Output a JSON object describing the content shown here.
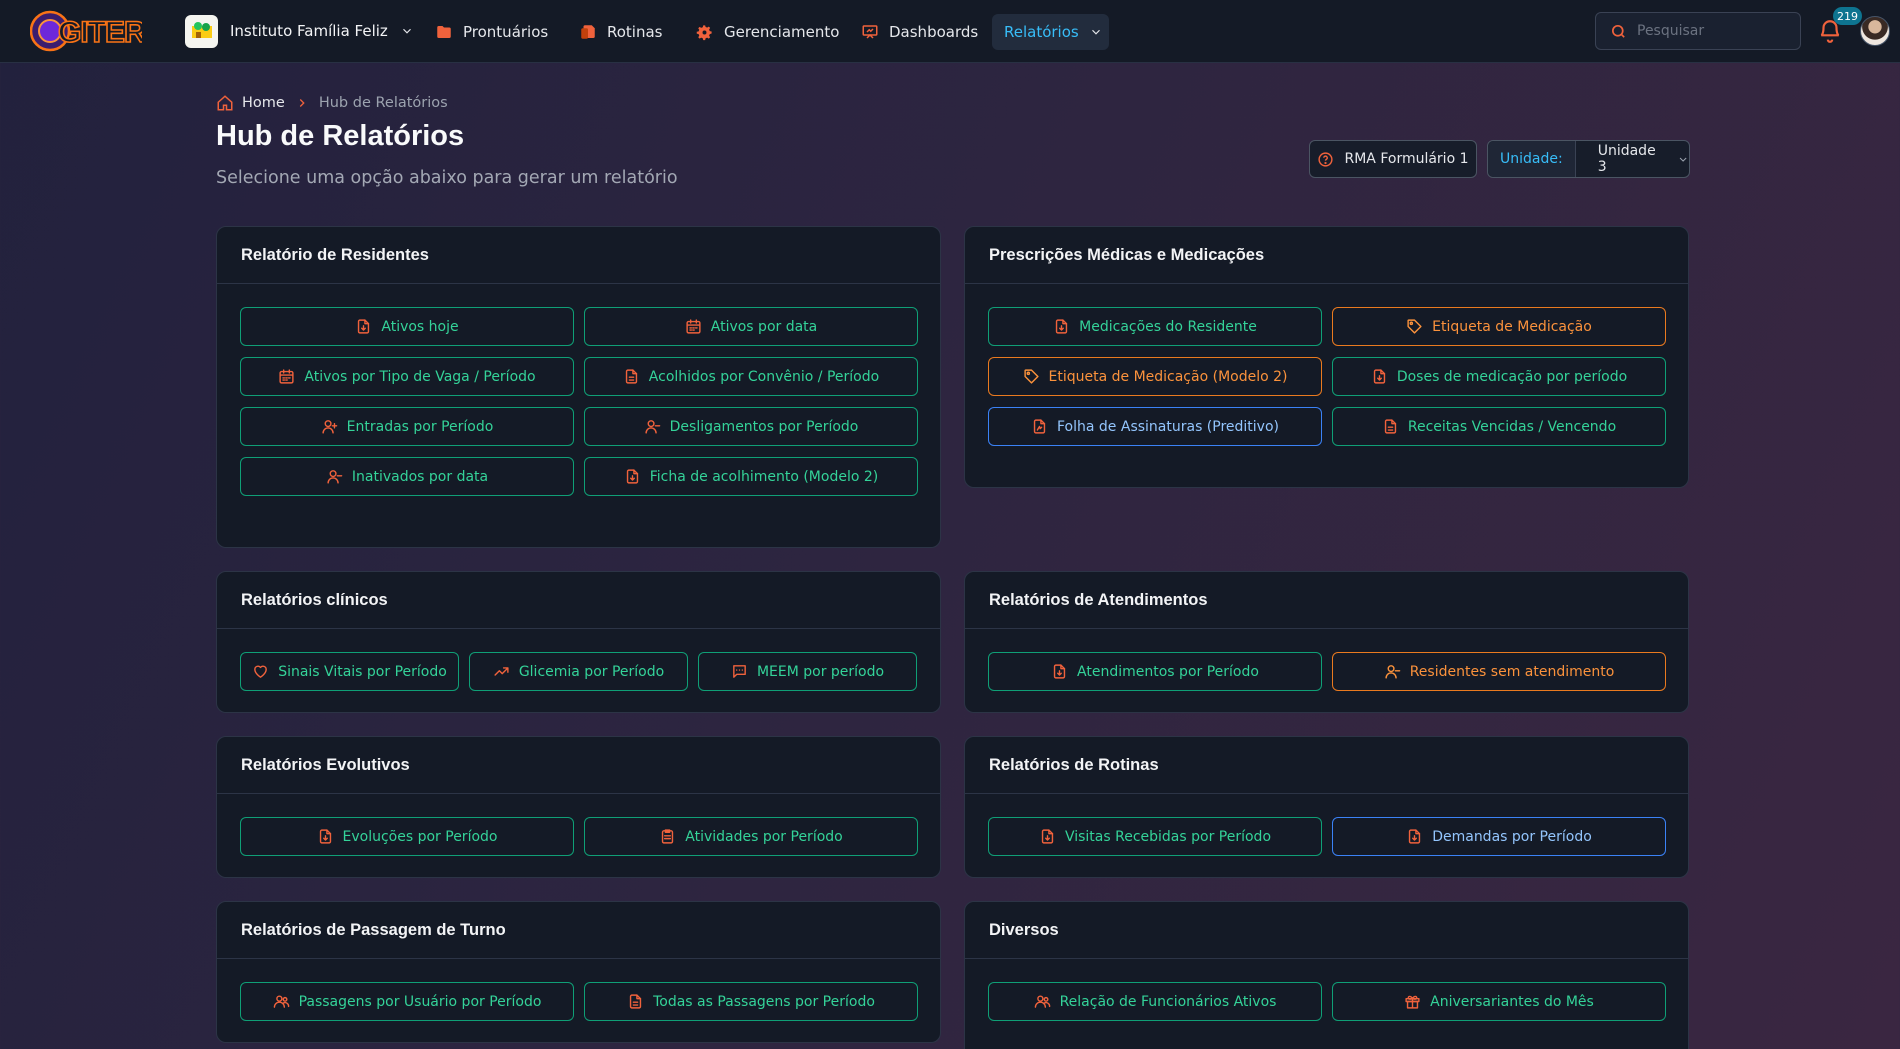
{
  "header": {
    "logo_text": "GITER",
    "org_name": "Instituto Família Feliz",
    "nav": [
      {
        "label": "Prontuários",
        "icon": "folder-icon"
      },
      {
        "label": "Rotinas",
        "icon": "documents-icon"
      },
      {
        "label": "Gerenciamento",
        "icon": "gear-icon"
      },
      {
        "label": "Dashboards",
        "icon": "presentation-chart-icon"
      },
      {
        "label": "Relatórios",
        "icon": "chevron-down-icon",
        "active": true
      }
    ],
    "search_placeholder": "Pesquisar",
    "notification_count": "219"
  },
  "breadcrumb": {
    "home": "Home",
    "current": "Hub de Relatórios"
  },
  "page": {
    "title": "Hub de Relatórios",
    "subtitle": "Selecione uma opção abaixo para gerar um relatório",
    "rma_button": "RMA Formulário 1",
    "unit_label": "Unidade:",
    "unit_value": "Unidade 3"
  },
  "colors": {
    "green": "#34d399",
    "orange": "#fb923c",
    "blue": "#93c5fd",
    "accent": "#38bdf8"
  },
  "sections": {
    "residentes": {
      "title": "Relatório de Residentes",
      "buttons": [
        {
          "label": "Ativos hoje",
          "icon": "file-download-icon",
          "color": "green"
        },
        {
          "label": "Ativos por data",
          "icon": "calendar-icon",
          "color": "green"
        },
        {
          "label": "Ativos por Tipo de Vaga / Período",
          "icon": "calendar-icon",
          "color": "green"
        },
        {
          "label": "Acolhidos por Convênio / Período",
          "icon": "file-icon",
          "color": "green"
        },
        {
          "label": "Entradas por Período",
          "icon": "user-plus-icon",
          "color": "green"
        },
        {
          "label": "Desligamentos por Período",
          "icon": "user-minus-icon",
          "color": "green"
        },
        {
          "label": "Inativados por data",
          "icon": "user-minus-icon",
          "color": "green"
        },
        {
          "label": "Ficha de acolhimento (Modelo 2)",
          "icon": "file-download-icon",
          "color": "green"
        }
      ]
    },
    "prescricoes": {
      "title": "Prescrições Médicas e Medicações",
      "buttons": [
        {
          "label": "Medicações do Residente",
          "icon": "file-download-icon",
          "color": "green"
        },
        {
          "label": "Etiqueta de Medicação",
          "icon": "tag-icon",
          "color": "orange"
        },
        {
          "label": "Etiqueta de Medicação (Modelo 2)",
          "icon": "tag-icon",
          "color": "orange"
        },
        {
          "label": "Doses de medicação por período",
          "icon": "file-download-icon",
          "color": "green"
        },
        {
          "label": "Folha de Assinaturas (Preditivo)",
          "icon": "file-signature-icon",
          "color": "blue"
        },
        {
          "label": "Receitas Vencidas / Vencendo",
          "icon": "file-icon",
          "color": "green"
        }
      ]
    },
    "clinicos": {
      "title": "Relatórios clínicos",
      "buttons": [
        {
          "label": "Sinais Vitais por Período",
          "icon": "heart-icon",
          "color": "green"
        },
        {
          "label": "Glicemia por Período",
          "icon": "trending-up-icon",
          "color": "green"
        },
        {
          "label": "MEEM por período",
          "icon": "chat-icon",
          "color": "green"
        }
      ]
    },
    "atendimentos": {
      "title": "Relatórios de Atendimentos",
      "buttons": [
        {
          "label": "Atendimentos por Período",
          "icon": "file-download-icon",
          "color": "green"
        },
        {
          "label": "Residentes sem atendimento",
          "icon": "user-minus-icon",
          "color": "orange"
        }
      ]
    },
    "evolutivos": {
      "title": "Relatórios Evolutivos",
      "buttons": [
        {
          "label": "Evoluções por Período",
          "icon": "file-download-icon",
          "color": "green"
        },
        {
          "label": "Atividades por Período",
          "icon": "clipboard-icon",
          "color": "green"
        }
      ]
    },
    "rotinas": {
      "title": "Relatórios de Rotinas",
      "buttons": [
        {
          "label": "Visitas Recebidas por Período",
          "icon": "file-download-icon",
          "color": "green"
        },
        {
          "label": "Demandas por Período",
          "icon": "file-download-icon",
          "color": "blue"
        }
      ]
    },
    "passagem": {
      "title": "Relatórios de Passagem de Turno",
      "buttons": [
        {
          "label": "Passagens por Usuário por Período",
          "icon": "users-icon",
          "color": "green"
        },
        {
          "label": "Todas as Passagens por Período",
          "icon": "file-icon",
          "color": "green"
        }
      ]
    },
    "diversos": {
      "title": "Diversos",
      "buttons": [
        {
          "label": "Relação de Funcionários Ativos",
          "icon": "users-icon",
          "color": "green"
        },
        {
          "label": "Aniversariantes do Mês",
          "icon": "gift-icon",
          "color": "green"
        }
      ]
    }
  }
}
